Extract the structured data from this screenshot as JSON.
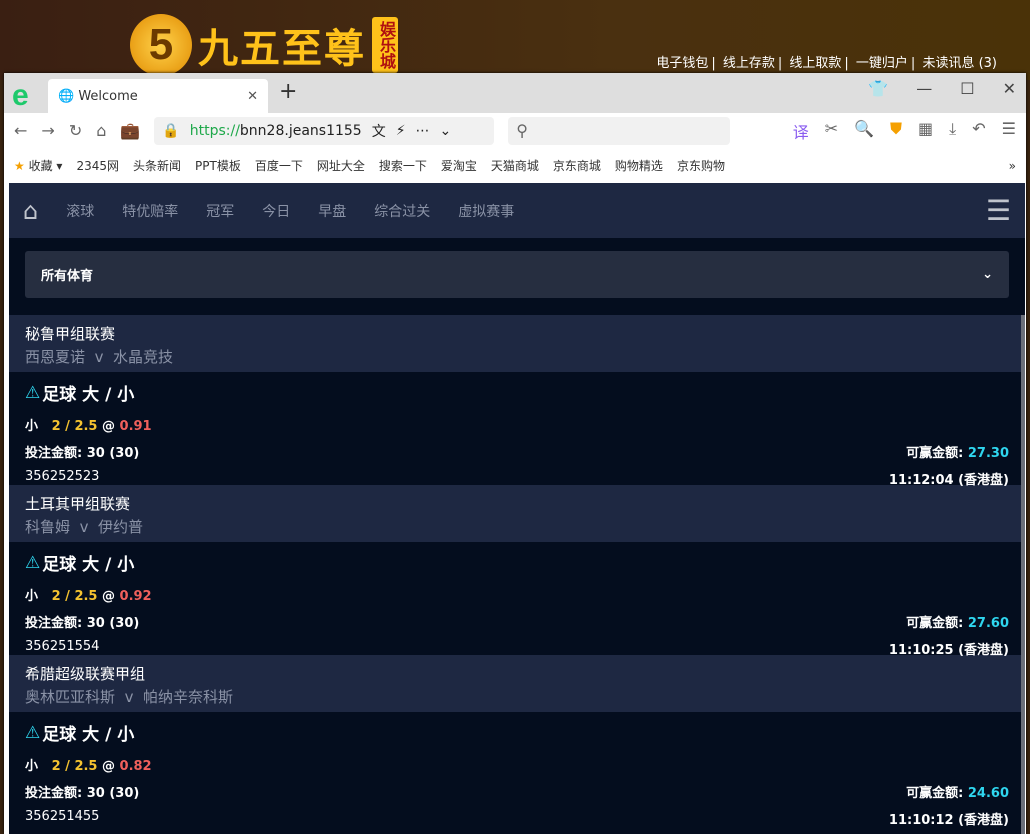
{
  "site": {
    "logo_number": "5",
    "logo_text": "九五至尊",
    "logo_tag": "娱乐城",
    "links": [
      "电子钱包",
      "线上存款",
      "线上取款",
      "一键归户",
      "未读讯息 (3)"
    ]
  },
  "browser": {
    "tab_title": "Welcome",
    "url_scheme": "https://",
    "url_rest": "bnn28.jeans1155",
    "bookmarks": [
      "收藏",
      "2345网",
      "头条新闻",
      "PPT模板",
      "百度一下",
      "网址大全",
      "搜索一下",
      "爱淘宝",
      "天猫商城",
      "京东商城",
      "购物精选",
      "京东购物"
    ]
  },
  "nav": {
    "items": [
      "滚球",
      "特优赔率",
      "冠军",
      "今日",
      "早盘",
      "综合过关",
      "虚拟赛事"
    ]
  },
  "filter": {
    "selected": "所有体育"
  },
  "labels": {
    "stake": "投注金额:",
    "win": "可赢金额:",
    "vs": "v"
  },
  "bets": [
    {
      "league": "秘鲁甲组联赛",
      "home": "西恩夏诺",
      "away": "水晶竞技",
      "type": "足球 大 / 小",
      "side": "小",
      "line": "2 / 2.5",
      "odds": "0.91",
      "stake": "30 (30)",
      "win": "27.30",
      "id": "356252523",
      "time": "11:12:04 (香港盘)"
    },
    {
      "league": "土耳其甲组联赛",
      "home": "科鲁姆",
      "away": "伊约普",
      "type": "足球 大 / 小",
      "side": "小",
      "line": "2 / 2.5",
      "odds": "0.92",
      "stake": "30 (30)",
      "win": "27.60",
      "id": "356251554",
      "time": "11:10:25 (香港盘)"
    },
    {
      "league": "希腊超级联赛甲组",
      "home": "奥林匹亚科斯",
      "away": "帕纳辛奈科斯",
      "type": "足球 大 / 小",
      "side": "小",
      "line": "2 / 2.5",
      "odds": "0.82",
      "stake": "30 (30)",
      "win": "24.60",
      "id": "356251455",
      "time": "11:10:12 (香港盘)"
    }
  ]
}
